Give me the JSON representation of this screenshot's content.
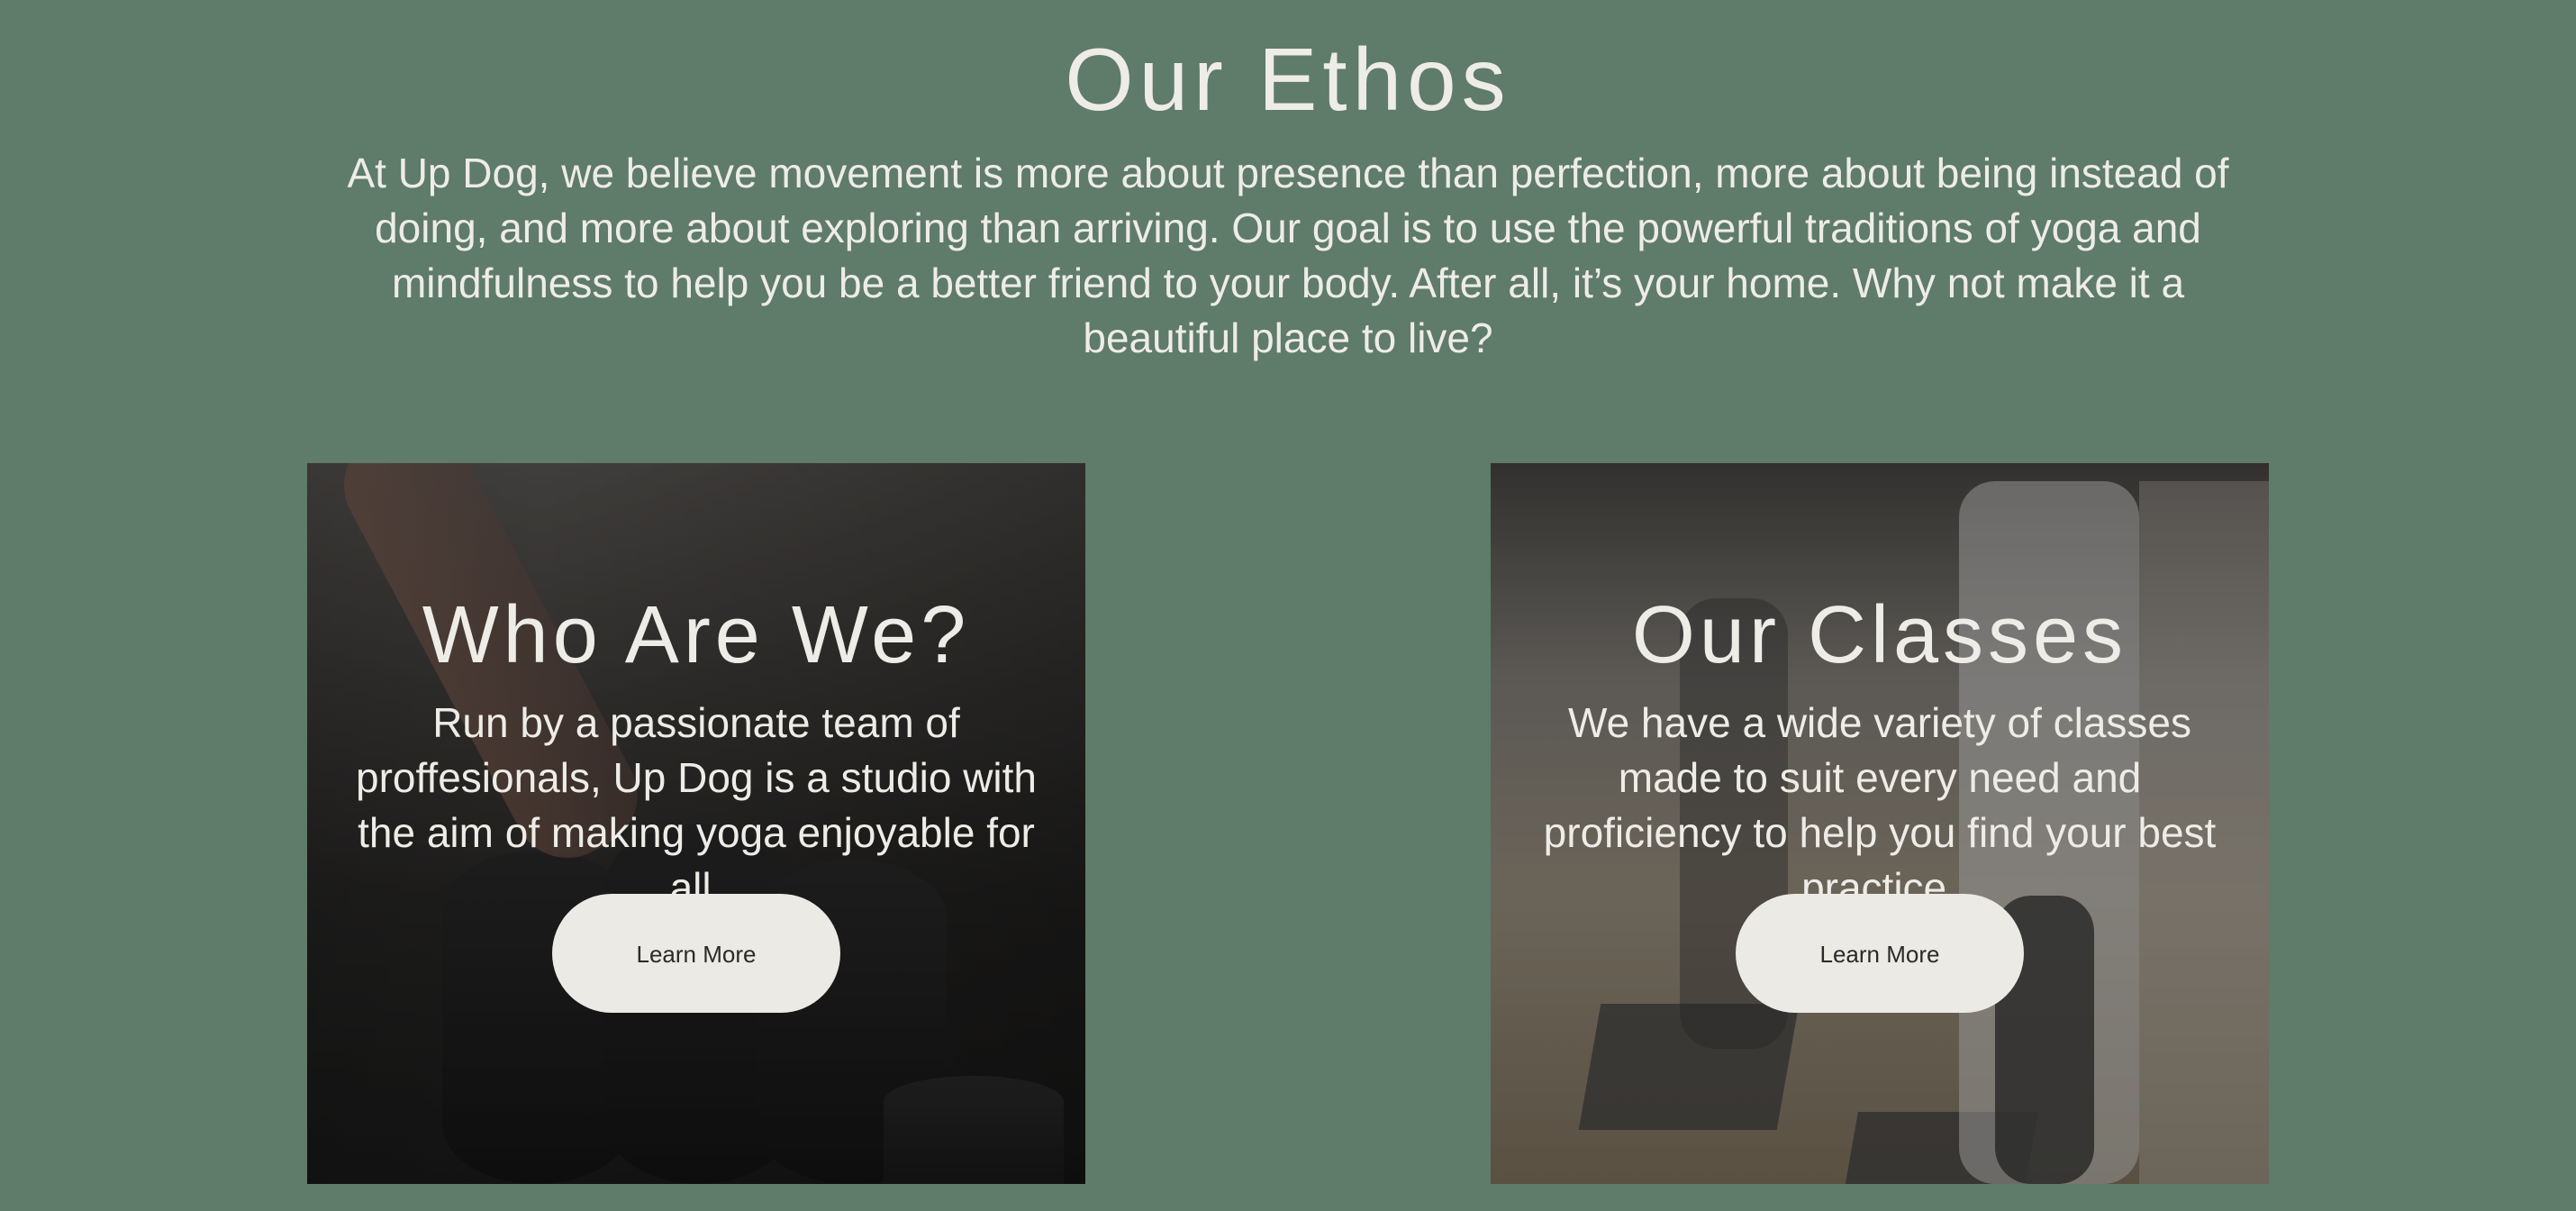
{
  "ethos": {
    "title": "Our Ethos",
    "text": "At Up Dog, we believe movement is more about presence than perfection, more about being instead of doing, and more about exploring than arriving. Our goal is to use the powerful traditions of yoga and mindfulness to help you be a better friend to your body. After all, it’s your home. Why not make it a beautiful place to live?"
  },
  "cards": [
    {
      "title": "Who Are We?",
      "text": "Run by a passionate team of proffesionals, Up Dog is a studio with the aim of making yoga enjoyable for all.",
      "button_label": "Learn More"
    },
    {
      "title": "Our Classes",
      "text": "We have a wide variety of classes made to suit every need and proficiency to help you find your best practice.",
      "button_label": "Learn More"
    }
  ],
  "colors": {
    "background": "#5f7b69",
    "text": "#eeece6",
    "button": "#eceae4",
    "button_text": "#2a2a2a"
  }
}
